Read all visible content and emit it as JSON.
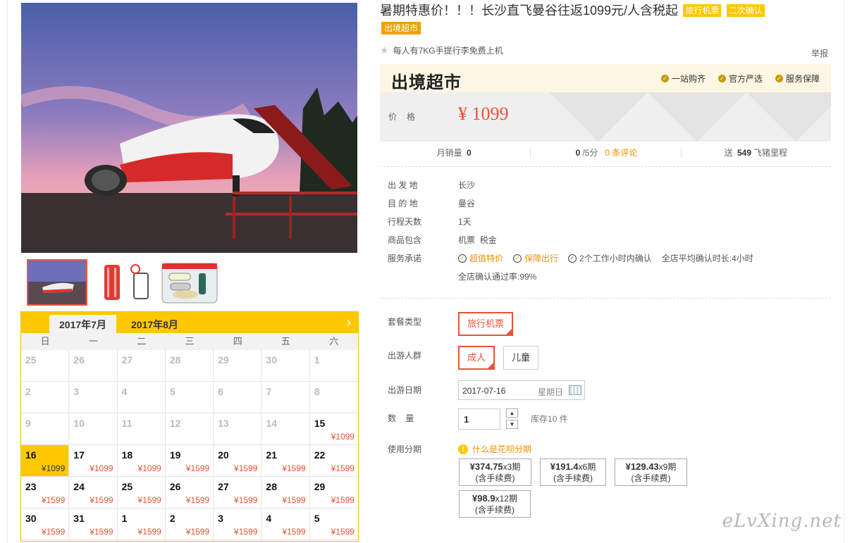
{
  "title": "暑期特惠价！！！长沙直飞曼谷往返1099元/人含税起",
  "badges": [
    "旅行机票",
    "二次确认",
    "出境超市"
  ],
  "subtitle": "每人有7KG手提行李免费上机",
  "report": "举报",
  "banner": {
    "brand": "出境超市",
    "guarantees": [
      "一站购齐",
      "官方严选",
      "服务保障"
    ],
    "price_label": "价格",
    "price": "¥ 1099"
  },
  "stats": {
    "monthly_sales_label": "月销量",
    "monthly_sales": "0",
    "score": "0",
    "score_suffix": "/5分",
    "reviews": "0 条评论",
    "miles_prefix": "送",
    "miles": "549",
    "miles_suffix": "飞猪里程"
  },
  "info": {
    "rows": [
      {
        "k": "出 发 地",
        "v": "长沙"
      },
      {
        "k": "目 的 地",
        "v": "曼谷"
      },
      {
        "k": "行程天数",
        "v": "1天"
      },
      {
        "k": "商品包含",
        "v": "机票  税金"
      }
    ],
    "service_label": "服务承诺",
    "services": [
      "超值特价",
      "保障出行",
      "2个工作小时内确认"
    ],
    "service_extra": [
      "全店平均确认时长:4小时",
      "全店确认通过率:99%"
    ]
  },
  "options": {
    "package_label": "套餐类型",
    "package": "旅行机票",
    "crowd_label": "出游人群",
    "crowd": [
      "成人",
      "儿童"
    ],
    "date_label": "出游日期",
    "date_value": "2017-07-16",
    "date_weekday": "星期日",
    "qty_label": "数    量",
    "qty_value": "1",
    "stock": "库存10 件",
    "installment_label": "使用分期",
    "installment_tip": "什么是花呗分期",
    "installments": [
      {
        "amount": "¥374.75",
        "periods": "x3期",
        "note": "(含手续费)"
      },
      {
        "amount": "¥191.4",
        "periods": "x6期",
        "note": "(含手续费)"
      },
      {
        "amount": "¥129.43",
        "periods": "x9期",
        "note": "(含手续费)"
      },
      {
        "amount": "¥98.9",
        "periods": "x12期",
        "note": "(含手续费)"
      }
    ]
  },
  "calendar": {
    "tabs": [
      "2017年7月",
      "2017年8月"
    ],
    "weekdays": [
      "日",
      "一",
      "二",
      "三",
      "四",
      "五",
      "六"
    ],
    "cells": [
      {
        "d": "25",
        "p": "",
        "past": true
      },
      {
        "d": "26",
        "p": "",
        "past": true
      },
      {
        "d": "27",
        "p": "",
        "past": true
      },
      {
        "d": "28",
        "p": "",
        "past": true
      },
      {
        "d": "29",
        "p": "",
        "past": true
      },
      {
        "d": "30",
        "p": "",
        "past": true
      },
      {
        "d": "1",
        "p": "",
        "past": true
      },
      {
        "d": "2",
        "p": "",
        "past": true
      },
      {
        "d": "3",
        "p": "",
        "past": true
      },
      {
        "d": "4",
        "p": "",
        "past": true
      },
      {
        "d": "5",
        "p": "",
        "past": true
      },
      {
        "d": "6",
        "p": "",
        "past": true
      },
      {
        "d": "7",
        "p": "",
        "past": true
      },
      {
        "d": "8",
        "p": "",
        "past": true
      },
      {
        "d": "9",
        "p": "",
        "past": true
      },
      {
        "d": "10",
        "p": "",
        "past": true
      },
      {
        "d": "11",
        "p": "",
        "past": true
      },
      {
        "d": "12",
        "p": "",
        "past": true
      },
      {
        "d": "13",
        "p": "",
        "past": true
      },
      {
        "d": "14",
        "p": "",
        "past": true
      },
      {
        "d": "15",
        "p": "¥1099"
      },
      {
        "d": "16",
        "p": "¥1099",
        "sel": true
      },
      {
        "d": "17",
        "p": "¥1099"
      },
      {
        "d": "18",
        "p": "¥1099"
      },
      {
        "d": "19",
        "p": "¥1599"
      },
      {
        "d": "20",
        "p": "¥1599"
      },
      {
        "d": "21",
        "p": "¥1599"
      },
      {
        "d": "22",
        "p": "¥1599"
      },
      {
        "d": "23",
        "p": "¥1599"
      },
      {
        "d": "24",
        "p": "¥1599"
      },
      {
        "d": "25",
        "p": "¥1599"
      },
      {
        "d": "26",
        "p": "¥1599"
      },
      {
        "d": "27",
        "p": "¥1599"
      },
      {
        "d": "28",
        "p": "¥1599"
      },
      {
        "d": "29",
        "p": "¥1599"
      },
      {
        "d": "30",
        "p": "¥1599"
      },
      {
        "d": "31",
        "p": "¥1599"
      },
      {
        "d": "1",
        "p": "¥1599"
      },
      {
        "d": "2",
        "p": "¥1599"
      },
      {
        "d": "3",
        "p": "¥1599"
      },
      {
        "d": "4",
        "p": "¥1599"
      },
      {
        "d": "5",
        "p": "¥1599"
      }
    ]
  },
  "watermark": "eLvXing.net",
  "colors": {
    "accent": "#fec800",
    "price": "#e8533a",
    "highlight": "#f09000"
  }
}
